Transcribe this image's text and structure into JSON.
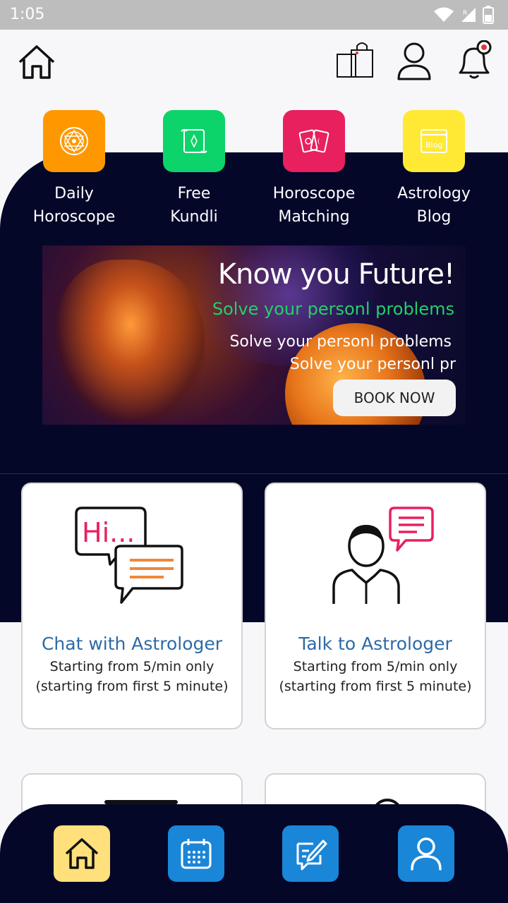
{
  "status_bar": {
    "time": "1:05",
    "icons": [
      "wifi-icon",
      "signal-icon",
      "battery-icon"
    ]
  },
  "header": {
    "icons": [
      "home-icon",
      "shopping-bag-icon",
      "user-icon",
      "notification-bell-icon"
    ]
  },
  "quick_links": [
    {
      "line1": "Daily",
      "line2": "Horoscope",
      "color": "#ff9800",
      "icon": "mandala-icon"
    },
    {
      "line1": "Free",
      "line2": "Kundli",
      "color": "#0dd46a",
      "icon": "scroll-icon"
    },
    {
      "line1": "Horoscope",
      "line2": "Matching",
      "color": "#e8205e",
      "icon": "tarot-cards-icon"
    },
    {
      "line1": "Astrology",
      "line2": "Blog",
      "color": "#ffe935",
      "icon": "blog-icon"
    }
  ],
  "banner": {
    "title": "Know you Future!",
    "subtitle_green": "Solve your personl problems",
    "line1": "Solve your personl problems",
    "line2": "Solve your personl pr",
    "cta": "BOOK NOW"
  },
  "cards": [
    {
      "title": "Chat with Astrologer",
      "line1": "Starting from 5/min only",
      "line2": "(starting from first 5 minute)",
      "icon": "chat-bubbles-icon",
      "bubble_text": "Hi..."
    },
    {
      "title": "Talk to Astrologer",
      "line1": "Starting from 5/min only",
      "line2": "(starting from first 5 minute)",
      "icon": "astrologer-talk-icon"
    }
  ],
  "bottom_nav": [
    {
      "icon": "home-icon",
      "color": "#ffe07a",
      "active": true
    },
    {
      "icon": "calendar-icon",
      "color": "#1a86d8",
      "active": false
    },
    {
      "icon": "edit-note-icon",
      "color": "#1a86d8",
      "active": false
    },
    {
      "icon": "profile-icon",
      "color": "#1a86d8",
      "active": false
    }
  ],
  "colors": {
    "navy": "#050729",
    "link_blue": "#2d6aa8",
    "accent_green": "#22d06a"
  }
}
